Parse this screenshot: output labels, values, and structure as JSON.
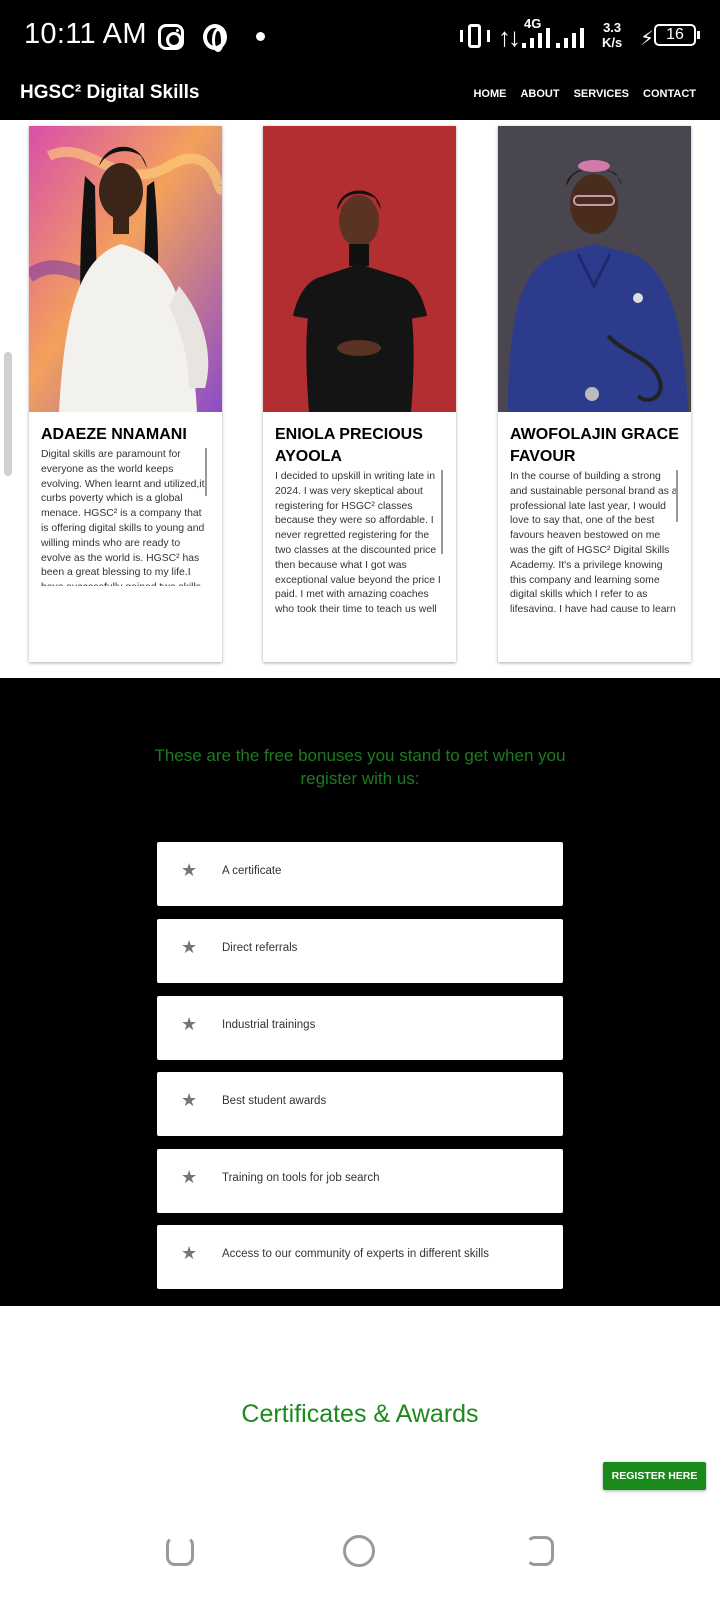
{
  "status_bar": {
    "time": "10:11 AM",
    "network": "4G",
    "speed_value": "3.3",
    "speed_unit": "K/s",
    "battery": "16"
  },
  "header": {
    "brand": "HGSC² Digital Skills",
    "nav": [
      "HOME",
      "ABOUT",
      "SERVICES",
      "CONTACT"
    ]
  },
  "testimonials": [
    {
      "name": "ADAEZE NNAMANI",
      "text": "Digital skills are paramount for everyone as the world keeps evolving. When learnt and utilized,it curbs poverty which is a global menace. HGSC² is a company that is offering digital skills to young and willing minds who are ready to evolve as the world is. HGSC² has been a great blessing to my life.I have successfully gained two skills"
    },
    {
      "name": "ENIOLA PRECIOUS AYOOLA",
      "text": "I decided to upskill in writing late in 2024. I was very skeptical about registering for HSGC² classes because they were so affordable. I never regretted registering for the two classes at the discounted price then because what I got was exceptional value beyond the price I paid. I met with amazing coaches who took their time to teach us well"
    },
    {
      "name": "AWOFOLAJIN GRACE FAVOUR",
      "text": "In the course of building a strong and sustainable personal brand as a professional late last year, I would love to say that, one of the best favours heaven bestowed on me was the gift of HGSC² Digital Skills Academy. It's a privilege knowing this company and learning some digital skills which I refer to as lifesaving. I have had cause to learn"
    }
  ],
  "bonuses": {
    "heading": "These are the free bonuses you stand to get when you register with us:",
    "items": [
      "A certificate",
      "Direct referrals",
      "Industrial trainings",
      "Best student awards",
      "Training on tools for job search",
      "Access to our community of experts in different skills"
    ]
  },
  "certificates": {
    "title": "Certificates & Awards"
  },
  "register_button": "REGISTER HERE",
  "colors": {
    "brand_green": "#1e8a1e",
    "dark": "#000000"
  }
}
